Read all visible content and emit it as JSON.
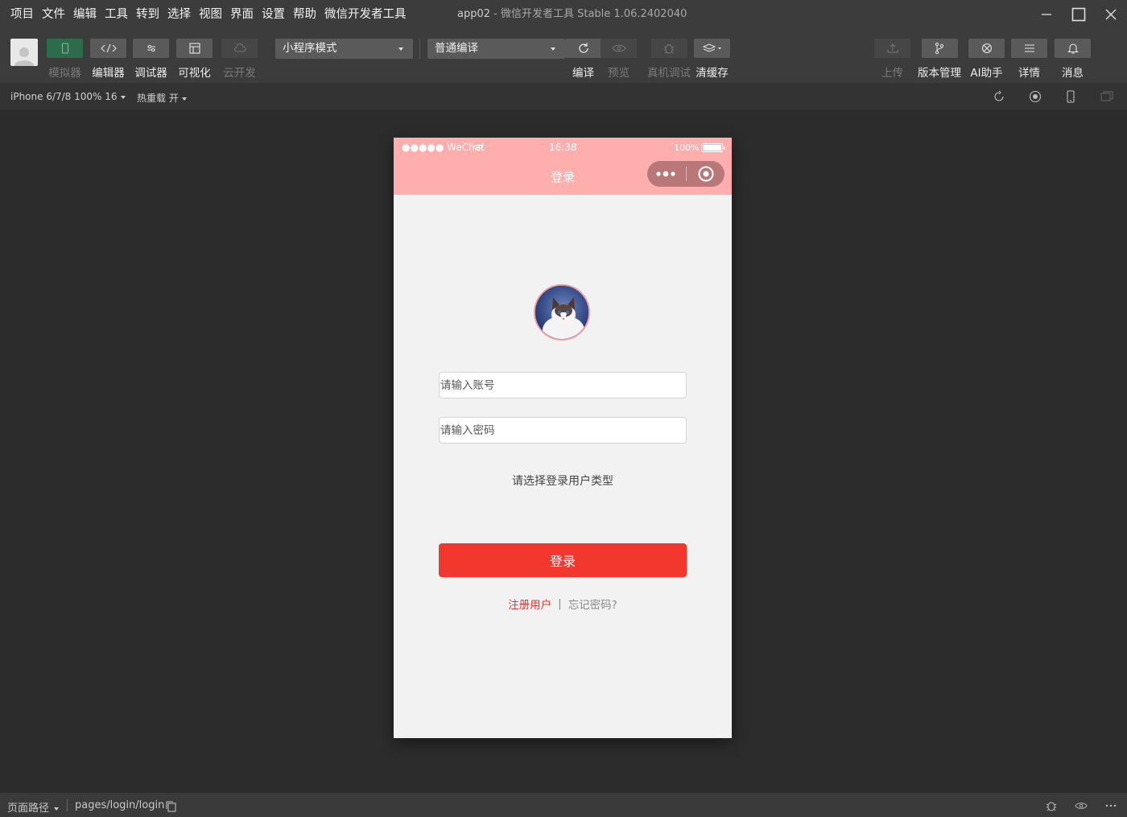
{
  "menu": [
    "项目",
    "文件",
    "编辑",
    "工具",
    "转到",
    "选择",
    "视图",
    "界面",
    "设置",
    "帮助",
    "微信开发者工具"
  ],
  "window_title": {
    "app": "app02",
    "rest": " - 微信开发者工具 Stable 1.06.2402040"
  },
  "toolbar": {
    "left_tools": [
      {
        "label": "模拟器",
        "icon": "phone-icon",
        "state": "active-dim"
      },
      {
        "label": "编辑器",
        "icon": "code-icon"
      },
      {
        "label": "调试器",
        "icon": "debug-icon"
      },
      {
        "label": "可视化",
        "icon": "layout-icon"
      },
      {
        "label": "云开发",
        "icon": "cloud-icon",
        "state": "disabled"
      }
    ],
    "mode_select": "小程序模式",
    "compile_select": "普通编译",
    "mid_tools": [
      {
        "label": "编译",
        "icon": "refresh-icon"
      },
      {
        "label": "预览",
        "icon": "eye-icon",
        "state": "disabled"
      },
      {
        "label": "真机调试",
        "icon": "bug-icon",
        "state": "disabled"
      },
      {
        "label": "清缓存",
        "icon": "layers-icon"
      }
    ],
    "right_tools": [
      {
        "label": "上传",
        "icon": "upload-icon",
        "state": "disabled"
      },
      {
        "label": "版本管理",
        "icon": "branch-icon"
      },
      {
        "label": "AI助手",
        "icon": "ai-icon"
      },
      {
        "label": "详情",
        "icon": "menu-icon"
      },
      {
        "label": "消息",
        "icon": "bell-icon"
      }
    ]
  },
  "device_bar": {
    "device": "iPhone 6/7/8 100% 16",
    "hot_reload": "热重载 开"
  },
  "phone": {
    "status": {
      "carrier": "●●●●● WeChat",
      "time": "16:38",
      "battery": "100%"
    },
    "nav_title": "登录",
    "nav_color": "#ffaeae",
    "account_placeholder": "请输入账号",
    "password_placeholder": "请输入密码",
    "user_type_prompt": "请选择登录用户类型",
    "login_button": "登录",
    "login_button_color": "#f2372d",
    "register_link": "注册用户",
    "separator": "|",
    "forgot_link": "忘记密码?"
  },
  "statusbar": {
    "page_path_label": "页面路径",
    "page_path": "pages/login/login"
  }
}
